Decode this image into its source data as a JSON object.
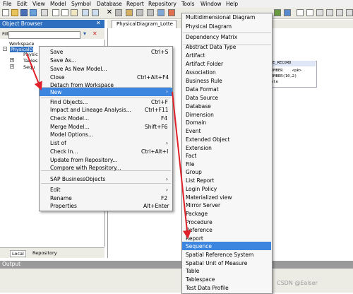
{
  "menubar": [
    "File",
    "Edit",
    "View",
    "Model",
    "Symbol",
    "Database",
    "Report",
    "Repository",
    "Tools",
    "Window",
    "Help"
  ],
  "object_browser": {
    "title": "Object Browser",
    "filter_label": "Filter",
    "tree": [
      "Workspace",
      "PhysicalD",
      "Physic",
      "Tables",
      "Sequ"
    ],
    "tabs": [
      "Local",
      "Repository"
    ]
  },
  "output": {
    "title": "Output"
  },
  "diagram": {
    "tab_label": "PhysicalDiagram_Lotte",
    "table_lines": [
      "E_RECORD",
      "UMBER    <pk>",
      "UMBER(10,2)",
      "ate"
    ]
  },
  "context_menu": {
    "items": [
      {
        "label": "Save",
        "shortcut": "Ctrl+S"
      },
      {
        "label": "Save As...",
        "shortcut": ""
      },
      {
        "label": "Save As New Model...",
        "shortcut": ""
      },
      {
        "label": "Close",
        "shortcut": "Ctrl+Alt+F4"
      },
      {
        "label": "Detach from Workspace",
        "shortcut": ""
      },
      {
        "label": "New",
        "shortcut": ""
      },
      {
        "label": "Find Objects...",
        "shortcut": "Ctrl+F"
      },
      {
        "label": "Impact and Lineage Analysis...",
        "shortcut": "Ctrl+F11"
      },
      {
        "label": "Check Model...",
        "shortcut": "F4"
      },
      {
        "label": "Merge Model...",
        "shortcut": "Shift+F6"
      },
      {
        "label": "Model Options...",
        "shortcut": ""
      },
      {
        "label": "List of",
        "shortcut": ""
      },
      {
        "label": "Check In...",
        "shortcut": "Ctrl+Alt+I"
      },
      {
        "label": "Update from Repository...",
        "shortcut": ""
      },
      {
        "label": "Compare with Repository...",
        "shortcut": ""
      },
      {
        "label": "SAP BusinessObjects",
        "shortcut": ""
      },
      {
        "label": "Edit",
        "shortcut": ""
      },
      {
        "label": "Rename",
        "shortcut": "F2"
      },
      {
        "label": "Properties",
        "shortcut": "Alt+Enter"
      }
    ]
  },
  "submenu": {
    "items": [
      "Multidimensional Diagram",
      "Physical Diagram",
      "Dependency Matrix",
      "Abstract Data Type",
      "Artifact",
      "Artifact Folder",
      "Association",
      "Business Rule",
      "Data Format",
      "Data Source",
      "Database",
      "Dimension",
      "Domain",
      "Event",
      "Extended Object",
      "Extension",
      "Fact",
      "File",
      "Group",
      "List Report",
      "Login Policy",
      "Materialized view",
      "Mirror Server",
      "Package",
      "Procedure",
      "Reference",
      "Report",
      "Sequence",
      "Spatial Reference System",
      "Spatial Unit of Measure",
      "Table",
      "Tablespace",
      "Test Data Profile"
    ],
    "selected": "Sequence"
  },
  "watermark": "CSDN @Ealser",
  "colors": {
    "highlight": "#3d86e0",
    "arrow": "#e0212a",
    "title_bar": "#2f6fc0"
  }
}
